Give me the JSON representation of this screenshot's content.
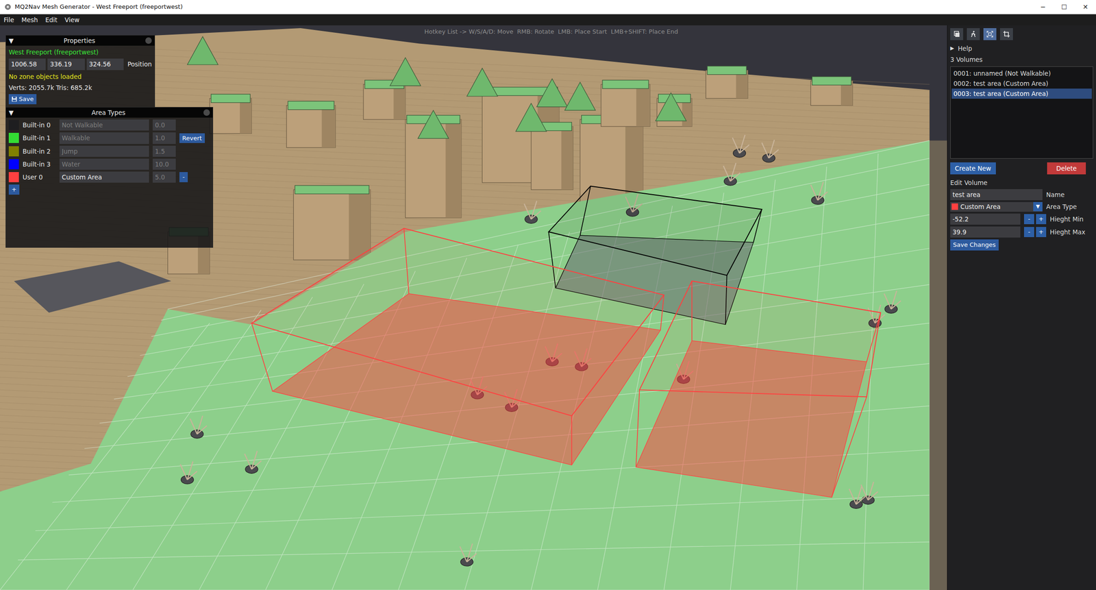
{
  "window": {
    "title": "MQ2Nav Mesh Generator - West Freeport (freeportwest)",
    "controls": [
      "─",
      "☐",
      "✕"
    ]
  },
  "menu": [
    {
      "label": "File"
    },
    {
      "label": "Mesh"
    },
    {
      "label": "Edit"
    },
    {
      "label": "View"
    }
  ],
  "hotkeys": "Hotkey List -> W/S/A/D: Move  RMB: Rotate  LMB: Place Start  LMB+SHIFT: Place End",
  "properties": {
    "arrow": "▼",
    "title": "Properties",
    "expanded": true,
    "zone": "West Freeport (freeportwest)",
    "position": [
      "1006.58",
      "336.19",
      "324.56"
    ],
    "position_label": "Position",
    "warning": "No zone objects loaded",
    "stats": "Verts: 2055.7k Tris: 685.2k",
    "save": "Save"
  },
  "area_types": {
    "arrow": "▼",
    "title": "Area Types",
    "expanded": true,
    "add": "+",
    "items": [
      {
        "label": "Built-in 0",
        "name": "Not Walkable",
        "cost": "0.0",
        "color": "#1e1e20",
        "disabled": true
      },
      {
        "label": "Built-in 1",
        "name": "Walkable",
        "cost": "1.0",
        "color": "#33dd33",
        "disabled": true,
        "button": "Revert"
      },
      {
        "label": "Built-in 2",
        "name": "Jump",
        "cost": "1.5",
        "color": "#808000",
        "disabled": true
      },
      {
        "label": "Built-in 3",
        "name": "Water",
        "cost": "10.0",
        "color": "#0000ff",
        "disabled": true
      },
      {
        "label": "User 0",
        "name": "Custom Area",
        "cost": "5.0",
        "color": "#ff4040",
        "disabled": false,
        "button": "-"
      }
    ]
  },
  "toolbar": [
    {
      "selected": false
    },
    {
      "selected": false
    },
    {
      "selected": true
    },
    {
      "selected": false
    }
  ],
  "help": {
    "arrow": "▶",
    "label": "Help",
    "expanded": false
  },
  "volumes": {
    "count_label": "3 Volumes",
    "create": "Create New",
    "delete": "Delete",
    "items": [
      {
        "label": "0001: unnamed (Not Walkable)",
        "selected": false,
        "color": "#000000"
      },
      {
        "label": "0002: test area (Custom Area)",
        "selected": false,
        "color": "#ff4040"
      },
      {
        "label": "0003: test area (Custom Area)",
        "selected": true,
        "color": "#ff4040"
      }
    ]
  },
  "edit": {
    "title": "Edit Volume",
    "name_value": "test area",
    "name_label": "Name",
    "area_type": "Custom Area",
    "area_color": "#ff4040",
    "dropdown_arrow": "▼",
    "area_label": "Area Type",
    "min": "-52.2",
    "min_label": "Hieght Min",
    "max": "39.9",
    "max_label": "Hieght Max",
    "minus": "-",
    "plus": "+",
    "save": "Save Changes"
  }
}
